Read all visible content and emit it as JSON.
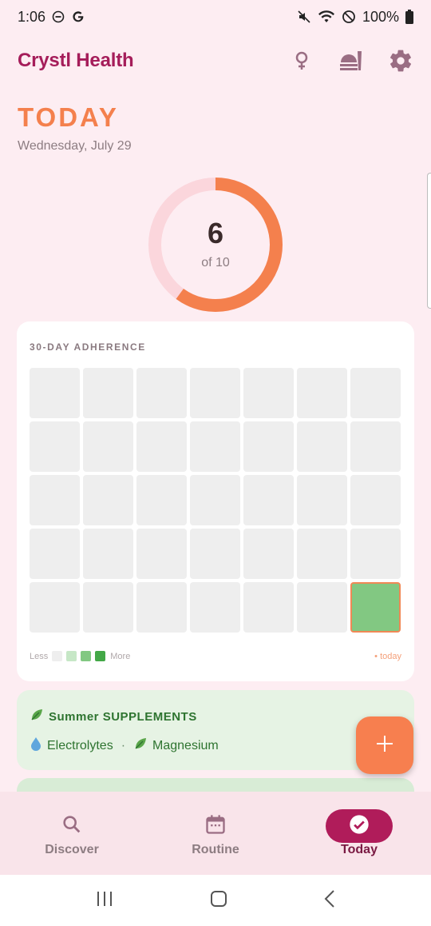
{
  "status": {
    "time": "1:06",
    "battery": "100%",
    "icons": [
      "do-not-disturb-icon",
      "google-icon",
      "mute-icon",
      "wifi-icon",
      "blocked-icon",
      "battery-icon"
    ]
  },
  "header": {
    "brand": "Crystl Health",
    "actions": [
      "female-symbol-icon",
      "food-icon",
      "settings-icon"
    ]
  },
  "today": {
    "title": "TODAY",
    "date": "Wednesday, July 29",
    "progress": {
      "taken": "6",
      "total_label": "of 10",
      "fraction": 0.6
    }
  },
  "adherence": {
    "label": "30-DAY ADHERENCE",
    "days": [
      0,
      0,
      0,
      0,
      0,
      0,
      0,
      0,
      0,
      0,
      0,
      0,
      0,
      0,
      0,
      0,
      0,
      0,
      0,
      0,
      0,
      0,
      0,
      0,
      0,
      0,
      0,
      0,
      0,
      0,
      0,
      0,
      0,
      0,
      2
    ],
    "today_index": 34,
    "legend": {
      "less": "Less",
      "more": "More",
      "today": "• today"
    },
    "colors": {
      "empty": "#eeeeee",
      "level1": "#c6e7c6",
      "level2": "#82c882",
      "level3": "#43a847",
      "today_border": "#f08856"
    }
  },
  "routine": {
    "title": "Summer SUPPLEMENTS",
    "title_icon": "leaf-icon",
    "items": [
      {
        "icon": "droplet-icon",
        "label": "Electrolytes"
      },
      {
        "icon": "leaf-icon",
        "label": "Magnesium"
      }
    ],
    "separator": "·"
  },
  "fab": {
    "icon": "plus-icon"
  },
  "bottom_nav": [
    {
      "label": "Discover",
      "icon": "search-icon",
      "active": false
    },
    {
      "label": "Routine",
      "icon": "calendar-icon",
      "active": false
    },
    {
      "label": "Today",
      "icon": "check-circle-icon",
      "active": true
    }
  ],
  "android_nav": [
    "recents-icon",
    "home-icon",
    "back-icon"
  ],
  "colors": {
    "accent": "#f4804d",
    "brand": "#a51d5a",
    "background": "#fdedf2"
  }
}
